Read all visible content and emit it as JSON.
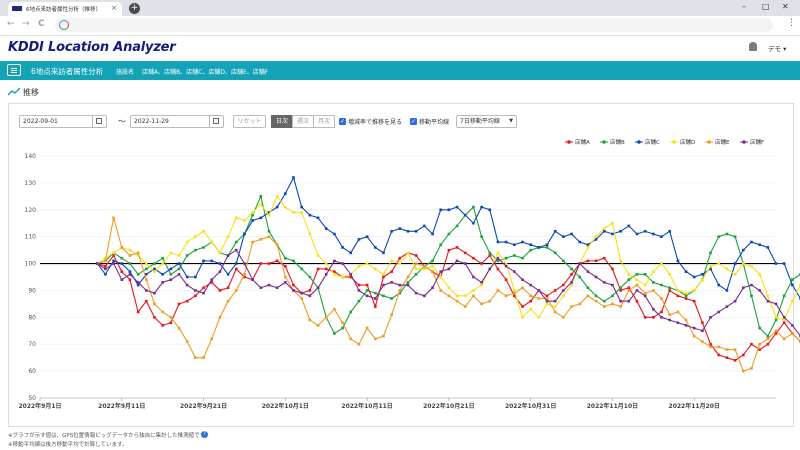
{
  "browser": {
    "tab_title": "6地点来訪者属性分析（推移）",
    "tab_close": "×",
    "new_tab": "+",
    "win_min": "–",
    "win_max": "□",
    "win_close": "✕",
    "back": "←",
    "forward": "→",
    "reload": "C",
    "menu": "⋮"
  },
  "header": {
    "logo": "KDDI Location Analyzer",
    "user": "デモ ▾"
  },
  "toolbar": {
    "analysis_title": "6地点来訪者属性分析",
    "facility_label": "施設名",
    "facilities": "店舗A、店舗B、店舗C、店舗D、店舗E、店舗F"
  },
  "section": {
    "title": "推移"
  },
  "controls": {
    "start_date": "2022-09-01",
    "tilde": "〜",
    "end_date": "2022-11-29",
    "reset": "リセット",
    "period_tabs": [
      "日次",
      "週次",
      "月次"
    ],
    "active_period": "日次",
    "check_rate_label": "増減率で推移を見る",
    "check_ma_label": "移動平均線",
    "ma_select": "7日移動平均線"
  },
  "footer": {
    "note1": "※グラフが示す値は、GPS位置情報ビッグデータから独自に集計した推測値です。",
    "note2": "※移動平均線は後方移動平均で計算しています。",
    "help": "?"
  },
  "chart_data": {
    "type": "line",
    "ylim": [
      50,
      140
    ],
    "yticks": [
      50,
      60,
      70,
      80,
      90,
      100,
      110,
      120,
      130,
      140
    ],
    "baseline": 100,
    "grid": true,
    "legend_position": "top-right",
    "xticks": [
      {
        "label": "2022年9月1日",
        "day": 0
      },
      {
        "label": "2022年9月11日",
        "day": 10
      },
      {
        "label": "2022年9月21日",
        "day": 20
      },
      {
        "label": "2022年10月1日",
        "day": 30
      },
      {
        "label": "2022年10月11日",
        "day": 40
      },
      {
        "label": "2022年10月21日",
        "day": 50
      },
      {
        "label": "2022年10月31日",
        "day": 60
      },
      {
        "label": "2022年11月10日",
        "day": 70
      },
      {
        "label": "2022年11月20日",
        "day": 80
      }
    ],
    "x_start_day": 7,
    "series": [
      {
        "name": "店舗A",
        "color": "#e6161b",
        "values": [
          100,
          99,
          103,
          97,
          94,
          82,
          86,
          80,
          77,
          78,
          85,
          86,
          88,
          91,
          93,
          90,
          91,
          98,
          95,
          94,
          100,
          100,
          101,
          99,
          92,
          89,
          90,
          98,
          98,
          97,
          95,
          95,
          92,
          92,
          84,
          95,
          97,
          102,
          104,
          103,
          99,
          97,
          95,
          105,
          106,
          104,
          102,
          100,
          103,
          98,
          94,
          88,
          84,
          86,
          90,
          88,
          90,
          92,
          96,
          100,
          101,
          101,
          102,
          98,
          90,
          91,
          86,
          80,
          80,
          82,
          90,
          88,
          87,
          86,
          78,
          70,
          66,
          65,
          64,
          66,
          70,
          68,
          70,
          74,
          78,
          74,
          71,
          76
        ]
      },
      {
        "name": "店舗B",
        "color": "#1aa23b",
        "values": [
          100,
          101,
          104,
          102,
          100,
          96,
          98,
          100,
          102,
          96,
          98,
          103,
          105,
          106,
          108,
          104,
          103,
          108,
          111,
          118,
          125,
          112,
          107,
          102,
          101,
          98,
          95,
          91,
          80,
          74,
          76,
          82,
          86,
          90,
          89,
          88,
          87,
          89,
          93,
          96,
          99,
          101,
          107,
          111,
          114,
          118,
          121,
          110,
          104,
          101,
          102,
          103,
          102,
          105,
          106,
          106,
          104,
          101,
          98,
          95,
          91,
          88,
          86,
          88,
          91,
          94,
          96,
          96,
          93,
          92,
          91,
          90,
          88,
          90,
          94,
          104,
          110,
          111,
          110,
          100,
          88,
          76,
          73,
          79,
          88,
          94,
          96,
          95,
          90,
          85
        ]
      },
      {
        "name": "店舗C",
        "color": "#0a47b4",
        "values": [
          100,
          96,
          101,
          100,
          97,
          92,
          96,
          98,
          96,
          98,
          100,
          95,
          95,
          101,
          101,
          100,
          96,
          100,
          111,
          116,
          117,
          119,
          121,
          126,
          132,
          121,
          118,
          117,
          113,
          111,
          106,
          104,
          109,
          110,
          106,
          104,
          112,
          113,
          112,
          112,
          114,
          111,
          120,
          120,
          121,
          118,
          115,
          121,
          120,
          108,
          108,
          107,
          108,
          107,
          106,
          107,
          112,
          110,
          111,
          108,
          107,
          109,
          112,
          111,
          112,
          114,
          111,
          112,
          111,
          110,
          112,
          101,
          97,
          95,
          96,
          98,
          92,
          90,
          100,
          105,
          108,
          107,
          106,
          100,
          100,
          92,
          87,
          84,
          82,
          78,
          76,
          72,
          72,
          73,
          75,
          81
        ]
      },
      {
        "name": "店舗D",
        "color": "#f5e11a",
        "values": [
          100,
          102,
          104,
          106,
          105,
          103,
          100,
          97,
          100,
          104,
          103,
          108,
          110,
          112,
          108,
          104,
          110,
          117,
          116,
          119,
          122,
          118,
          125,
          121,
          119,
          119,
          111,
          103,
          100,
          96,
          95,
          96,
          99,
          100,
          98,
          96,
          101,
          100,
          104,
          98,
          98,
          99,
          95,
          91,
          88,
          88,
          90,
          92,
          98,
          104,
          100,
          90,
          80,
          83,
          80,
          85,
          84,
          88,
          92,
          100,
          106,
          110,
          113,
          115,
          101,
          96,
          94,
          92,
          97,
          100,
          96,
          90,
          89,
          90,
          94,
          99,
          100,
          98,
          96,
          100,
          99,
          96,
          88,
          80,
          79,
          86,
          92,
          88,
          86
        ]
      },
      {
        "name": "店舗E",
        "color": "#f09a24",
        "values": [
          100,
          101,
          117,
          106,
          103,
          104,
          94,
          85,
          82,
          80,
          76,
          71,
          65,
          65,
          72,
          80,
          86,
          90,
          96,
          108,
          109,
          110,
          107,
          95,
          90,
          87,
          79,
          77,
          80,
          83,
          78,
          72,
          70,
          76,
          72,
          73,
          81,
          90,
          95,
          100,
          99,
          97,
          90,
          88,
          86,
          84,
          88,
          85,
          86,
          90,
          88,
          89,
          91,
          88,
          87,
          87,
          82,
          80,
          84,
          85,
          88,
          86,
          84,
          85,
          84,
          90,
          92,
          89,
          90,
          87,
          81,
          82,
          79,
          73,
          71,
          69,
          69,
          68,
          68,
          60,
          61,
          70,
          72,
          75,
          72,
          74,
          71,
          80
        ]
      },
      {
        "name": "店舗F",
        "color": "#7b2c8e",
        "values": [
          100,
          98,
          100,
          94,
          96,
          93,
          90,
          89,
          93,
          94,
          96,
          92,
          90,
          89,
          94,
          97,
          103,
          105,
          100,
          94,
          91,
          92,
          91,
          93,
          90,
          89,
          88,
          91,
          96,
          101,
          100,
          96,
          90,
          88,
          87,
          92,
          93,
          92,
          92,
          89,
          88,
          91,
          97,
          98,
          101,
          100,
          95,
          93,
          98,
          102,
          99,
          97,
          94,
          92,
          90,
          86,
          86,
          90,
          93,
          100,
          97,
          95,
          93,
          92,
          86,
          86,
          90,
          88,
          83,
          80,
          79,
          78,
          77,
          76,
          75,
          80,
          82,
          84,
          86,
          91,
          92,
          90,
          86,
          85,
          80,
          77,
          73,
          75,
          72
        ]
      }
    ]
  }
}
